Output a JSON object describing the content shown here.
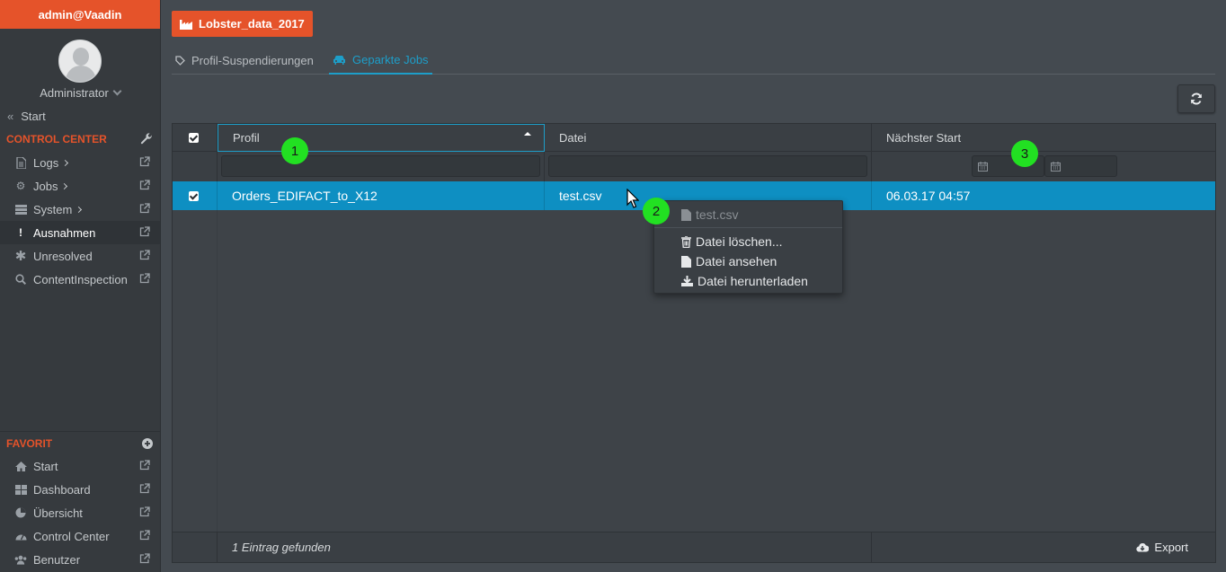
{
  "sidebar": {
    "user": "admin@Vaadin",
    "role": "Administrator",
    "start": "Start",
    "control_center_title": "CONTROL CENTER",
    "nav": [
      {
        "label": "Logs",
        "icon": "document-icon",
        "submenu": true
      },
      {
        "label": "Jobs",
        "icon": "jobs-icon",
        "submenu": true
      },
      {
        "label": "System",
        "icon": "server-icon",
        "submenu": true
      },
      {
        "label": "Ausnahmen",
        "icon": "exclamation-icon",
        "submenu": false,
        "active": true
      },
      {
        "label": "Unresolved",
        "icon": "asterisk-icon",
        "submenu": false
      },
      {
        "label": "ContentInspection",
        "icon": "zoom-icon",
        "submenu": false
      }
    ],
    "favorit_title": "FAVORIT",
    "favorites": [
      {
        "label": "Start",
        "icon": "home-icon"
      },
      {
        "label": "Dashboard",
        "icon": "grid-icon"
      },
      {
        "label": "Übersicht",
        "icon": "piechart-icon"
      },
      {
        "label": "Control Center",
        "icon": "gauge-icon"
      },
      {
        "label": "Benutzer",
        "icon": "users-icon"
      }
    ]
  },
  "main": {
    "project_button": "Lobster_data_2017",
    "tabs": [
      {
        "label": "Profil-Suspendierungen",
        "icon": "tag-icon",
        "active": false
      },
      {
        "label": "Geparkte Jobs",
        "icon": "car-icon",
        "active": true
      }
    ],
    "grid": {
      "columns": [
        "Profil",
        "Datei",
        "Nächster Start"
      ],
      "rows": [
        {
          "profil": "Orders_EDIFACT_to_X12",
          "datei": "test.csv",
          "start": "06.03.17 04:57",
          "selected": true
        }
      ],
      "footer_count": "1 Eintrag gefunden",
      "export_label": "Export"
    },
    "context_menu": {
      "title": "test.csv",
      "items": [
        "Datei löschen...",
        "Datei ansehen",
        "Datei herunterladen"
      ]
    },
    "markers": [
      "1",
      "2",
      "3"
    ]
  },
  "colors": {
    "accent": "#e5532a",
    "selection": "#0e8fc2",
    "tab_active": "#1d9ec9",
    "marker": "#22e022"
  }
}
